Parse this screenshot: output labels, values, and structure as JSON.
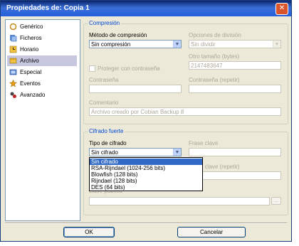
{
  "window": {
    "title": "Propiedades de: Copia 1"
  },
  "sidebar": {
    "items": [
      {
        "label": "Genérico",
        "icon": "generic-icon"
      },
      {
        "label": "Ficheros",
        "icon": "files-icon"
      },
      {
        "label": "Horario",
        "icon": "clock-icon"
      },
      {
        "label": "Archivo",
        "icon": "archive-icon",
        "selected": true
      },
      {
        "label": "Especial",
        "icon": "special-icon"
      },
      {
        "label": "Eventos",
        "icon": "events-icon"
      },
      {
        "label": "Avanzado",
        "icon": "advanced-icon"
      }
    ]
  },
  "compression": {
    "title": "Compresión",
    "method_label": "Método de compresión",
    "method_value": "Sin compresión",
    "split_label": "Opciones de división",
    "split_value": "Sin dividir",
    "other_size_label": "Otro tamaño (bytes)",
    "other_size_value": "2147483647",
    "protect_label": "Proteger con contraseña",
    "password_label": "Contraseña",
    "password_repeat_label": "Contraseña (repetir)",
    "comment_label": "Comentario",
    "comment_value": "Archivo creado por Cobian Backup 8"
  },
  "encryption": {
    "title": "Cifrado fuerte",
    "type_label": "Tipo de cifrado",
    "type_value": "Sin cifrado",
    "options": [
      "Sin cifrado",
      "RSA-Rijndael (1024-256 bits)",
      "Blowfish (128 bits)",
      "Rijndael (128 bits)",
      "DES (64 bits)"
    ],
    "passphrase_label": "Frase clave",
    "passphrase_repeat_label": "Frase clave (repetir)",
    "public_key_label": "Llave pública",
    "browse_label": "..."
  },
  "buttons": {
    "ok": "OK",
    "cancel": "Cancelar"
  },
  "colors": {
    "titlebar": "#245edb",
    "group_title": "#0046d5",
    "selection": "#316ac5",
    "sidebar_selection": "#c7c7e0"
  }
}
